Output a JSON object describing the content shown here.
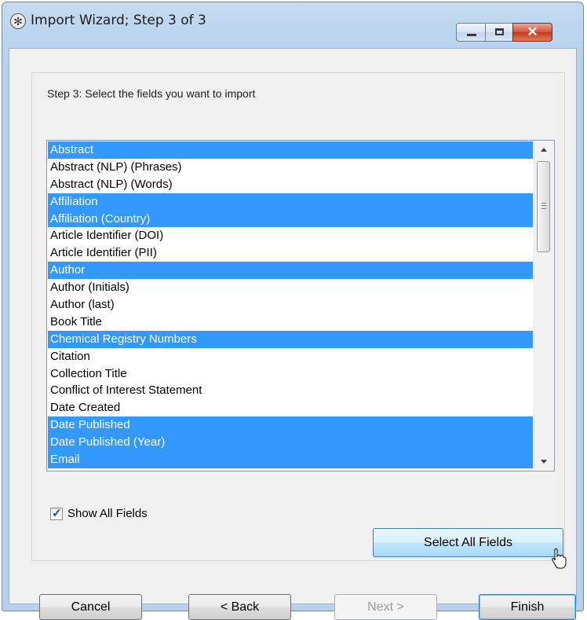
{
  "window": {
    "title": "Import Wizard; Step 3 of 3",
    "icon": "gear-app-icon",
    "controls": {
      "minimize": "minimize-icon",
      "maximize": "maximize-icon",
      "close": "close-icon"
    }
  },
  "step": {
    "instruction": "Step 3: Select the fields you want to import"
  },
  "fields": {
    "items": [
      {
        "label": "Abstract",
        "selected": true
      },
      {
        "label": "Abstract (NLP) (Phrases)",
        "selected": false
      },
      {
        "label": "Abstract (NLP) (Words)",
        "selected": false
      },
      {
        "label": "Affiliation",
        "selected": true
      },
      {
        "label": "Affiliation (Country)",
        "selected": true
      },
      {
        "label": "Article Identifier (DOI)",
        "selected": false
      },
      {
        "label": "Article Identifier (PII)",
        "selected": false
      },
      {
        "label": "Author",
        "selected": true
      },
      {
        "label": "Author (Initials)",
        "selected": false
      },
      {
        "label": "Author (last)",
        "selected": false
      },
      {
        "label": "Book Title",
        "selected": false
      },
      {
        "label": "Chemical Registry Numbers",
        "selected": true
      },
      {
        "label": "Citation",
        "selected": false
      },
      {
        "label": "Collection Title",
        "selected": false
      },
      {
        "label": "Conflict of Interest Statement",
        "selected": false
      },
      {
        "label": "Date Created",
        "selected": false
      },
      {
        "label": "Date Published",
        "selected": true
      },
      {
        "label": "Date Published (Year)",
        "selected": true
      },
      {
        "label": "Email",
        "selected": true
      }
    ]
  },
  "options": {
    "show_all_fields_label": "Show All Fields",
    "show_all_fields_checked": true,
    "select_all_label": "Select All Fields"
  },
  "footer": {
    "cancel_label": "Cancel",
    "back_label": "< Back",
    "next_label": "Next >",
    "next_enabled": false,
    "finish_label": "Finish"
  },
  "colors": {
    "selection": "#3399ff",
    "titlebar": "#bcd5ee",
    "close_button": "#c94a2b",
    "dialog_background": "#f0f0f0"
  }
}
